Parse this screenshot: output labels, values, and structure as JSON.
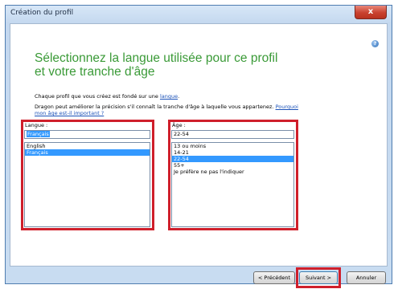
{
  "window": {
    "title": "Création du profil",
    "close_label": "x"
  },
  "help_icon_glyph": "?",
  "heading": {
    "line1": "Sélectionnez la langue utilisée pour ce profil",
    "line2": "et votre tranche d'âge"
  },
  "desc1": {
    "text": "Chaque profil que vous créez est fondé sur une ",
    "link": "langue",
    "suffix": "."
  },
  "desc2": {
    "text": "Dragon peut améliorer la précision s'il connaît la tranche d'âge à laquelle vous appartenez. ",
    "link_line1": "Pourquoi",
    "link_line2": "mon âge est-il important ?"
  },
  "language": {
    "label": "Langue :",
    "value": "Français",
    "items": [
      {
        "label": "English",
        "selected": false
      },
      {
        "label": "Français",
        "selected": true
      }
    ]
  },
  "age": {
    "label": "Âge :",
    "value": "22-54",
    "items": [
      {
        "label": "13 ou moins",
        "selected": false
      },
      {
        "label": "14-21",
        "selected": false
      },
      {
        "label": "22-54",
        "selected": true
      },
      {
        "label": "55+",
        "selected": false
      },
      {
        "label": "Je préfère ne pas l'indiquer",
        "selected": false
      }
    ]
  },
  "buttons": {
    "previous": "< Précédent",
    "next": "Suivant >",
    "cancel": "Annuler"
  },
  "colors": {
    "heading": "#3a9a37",
    "highlight": "#cf1f2b",
    "selection": "#3399ff"
  }
}
